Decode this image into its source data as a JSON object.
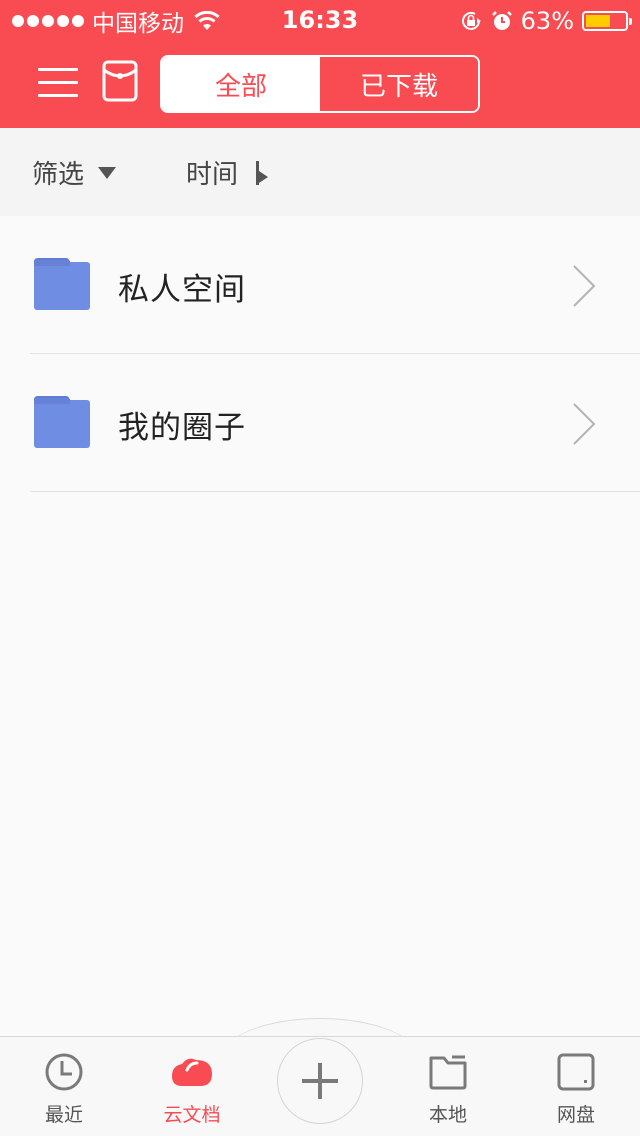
{
  "status_bar": {
    "carrier": "中国移动",
    "time": "16:33",
    "battery_percent_label": "63%",
    "battery_level": 0.63,
    "icons": [
      "signal-dots",
      "wifi-icon",
      "orientation-lock-icon",
      "alarm-icon",
      "battery-icon"
    ]
  },
  "header": {
    "menu_icon": "hamburger-menu-icon",
    "envelope_icon": "red-envelope-icon",
    "segments": [
      {
        "label": "全部",
        "active": true
      },
      {
        "label": "已下载",
        "active": false
      }
    ]
  },
  "filter_bar": {
    "filter_label": "筛选",
    "sort_label": "时间"
  },
  "list": {
    "items": [
      {
        "label": "私人空间",
        "icon": "folder-icon"
      },
      {
        "label": "我的圈子",
        "icon": "folder-icon"
      }
    ]
  },
  "tabbar": {
    "tabs": [
      {
        "label": "最近",
        "icon": "clock-icon",
        "active": false
      },
      {
        "label": "云文档",
        "icon": "cloud-icon",
        "active": true
      },
      {
        "label": "本地",
        "icon": "folder-outline-icon",
        "active": false
      },
      {
        "label": "网盘",
        "icon": "drive-icon",
        "active": false
      }
    ],
    "add_icon": "plus-icon"
  },
  "colors": {
    "brand_red": "#f84b52",
    "folder_blue": "#6f8de2",
    "battery_yellow": "#ffcc00"
  }
}
